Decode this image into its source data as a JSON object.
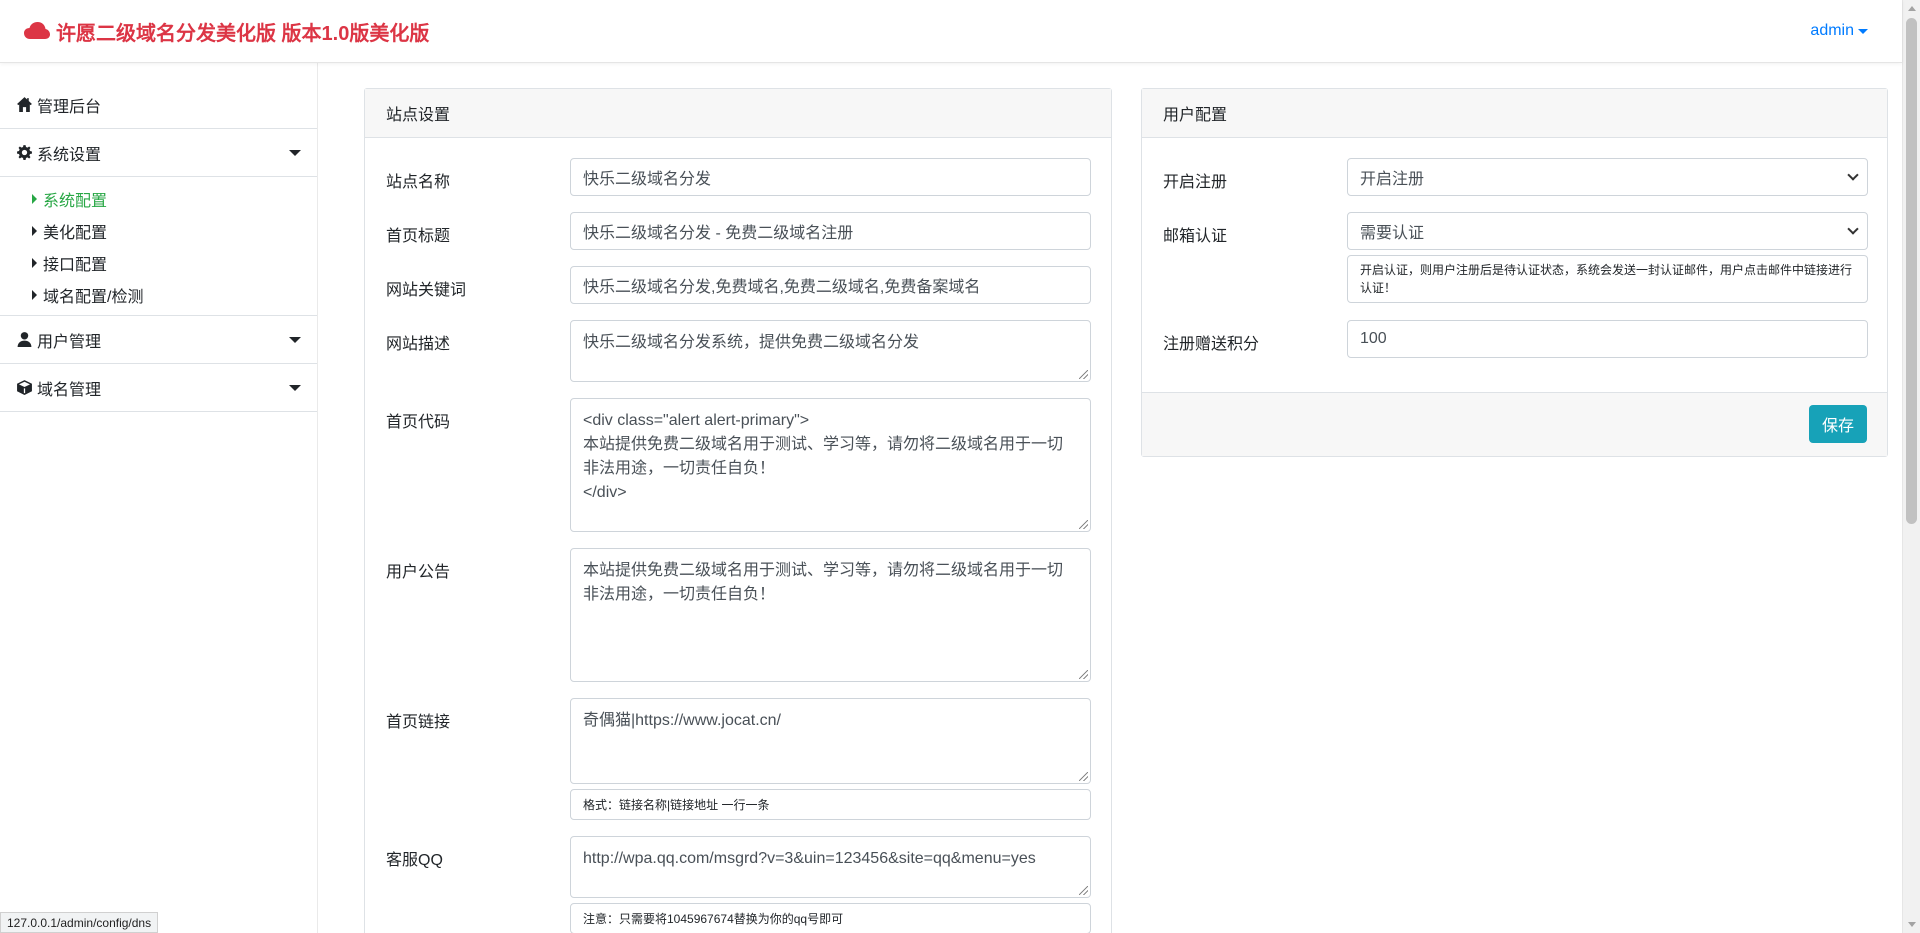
{
  "navbar": {
    "brand": "许愿二级域名分发美化版 版本1.0版美化版",
    "user": "admin",
    "brand_color": "#dc3545",
    "user_color": "#007bff"
  },
  "sidebar": {
    "dashboard": "管理后台",
    "system_settings": "系统设置",
    "system_items": [
      "系统配置",
      "美化配置",
      "接口配置",
      "域名配置/检测"
    ],
    "user_mgmt": "用户管理",
    "domain_mgmt": "域名管理",
    "active_color": "#28a745"
  },
  "site_settings": {
    "title": "站点设置",
    "site_name_label": "站点名称",
    "site_name_value": "快乐二级域名分发",
    "home_title_label": "首页标题",
    "home_title_value": "快乐二级域名分发 - 免费二级域名注册",
    "keywords_label": "网站关键词",
    "keywords_value": "快乐二级域名分发,免费域名,免费二级域名,免费备案域名",
    "description_label": "网站描述",
    "description_value": "快乐二级域名分发系统，提供免费二级域名分发",
    "home_code_label": "首页代码",
    "home_code_value": "<div class=\"alert alert-primary\">\n本站提供免费二级域名用于测试、学习等，请勿将二级域名用于一切\n非法用途，一切责任自负！\n</div>",
    "notice_label": "用户公告",
    "notice_value": "本站提供免费二级域名用于测试、学习等，请勿将二级域名用于一切\n非法用途，一切责任自负！",
    "home_links_label": "首页链接",
    "home_links_value": "奇偶猫|https://www.jocat.cn/",
    "home_links_hint": "格式：链接名称|链接地址 一行一条",
    "qq_label": "客服QQ",
    "qq_value": "http://wpa.qq.com/msgrd?v=3&uin=123456&site=qq&menu=yes",
    "qq_hint": "注意：只需要将1045967674替换为你的qq号即可"
  },
  "user_config": {
    "title": "用户配置",
    "register_label": "开启注册",
    "register_value": "开启注册",
    "email_label": "邮箱认证",
    "email_value": "需要认证",
    "email_hint": "开启认证，则用户注册后是待认证状态，系统会发送一封认证邮件，用户点击邮件中链接进行认证！",
    "points_label": "注册赠送积分",
    "points_value": "100",
    "save_label": "保存",
    "save_color": "#17a2b8"
  },
  "status_url": "127.0.0.1/admin/config/dns"
}
